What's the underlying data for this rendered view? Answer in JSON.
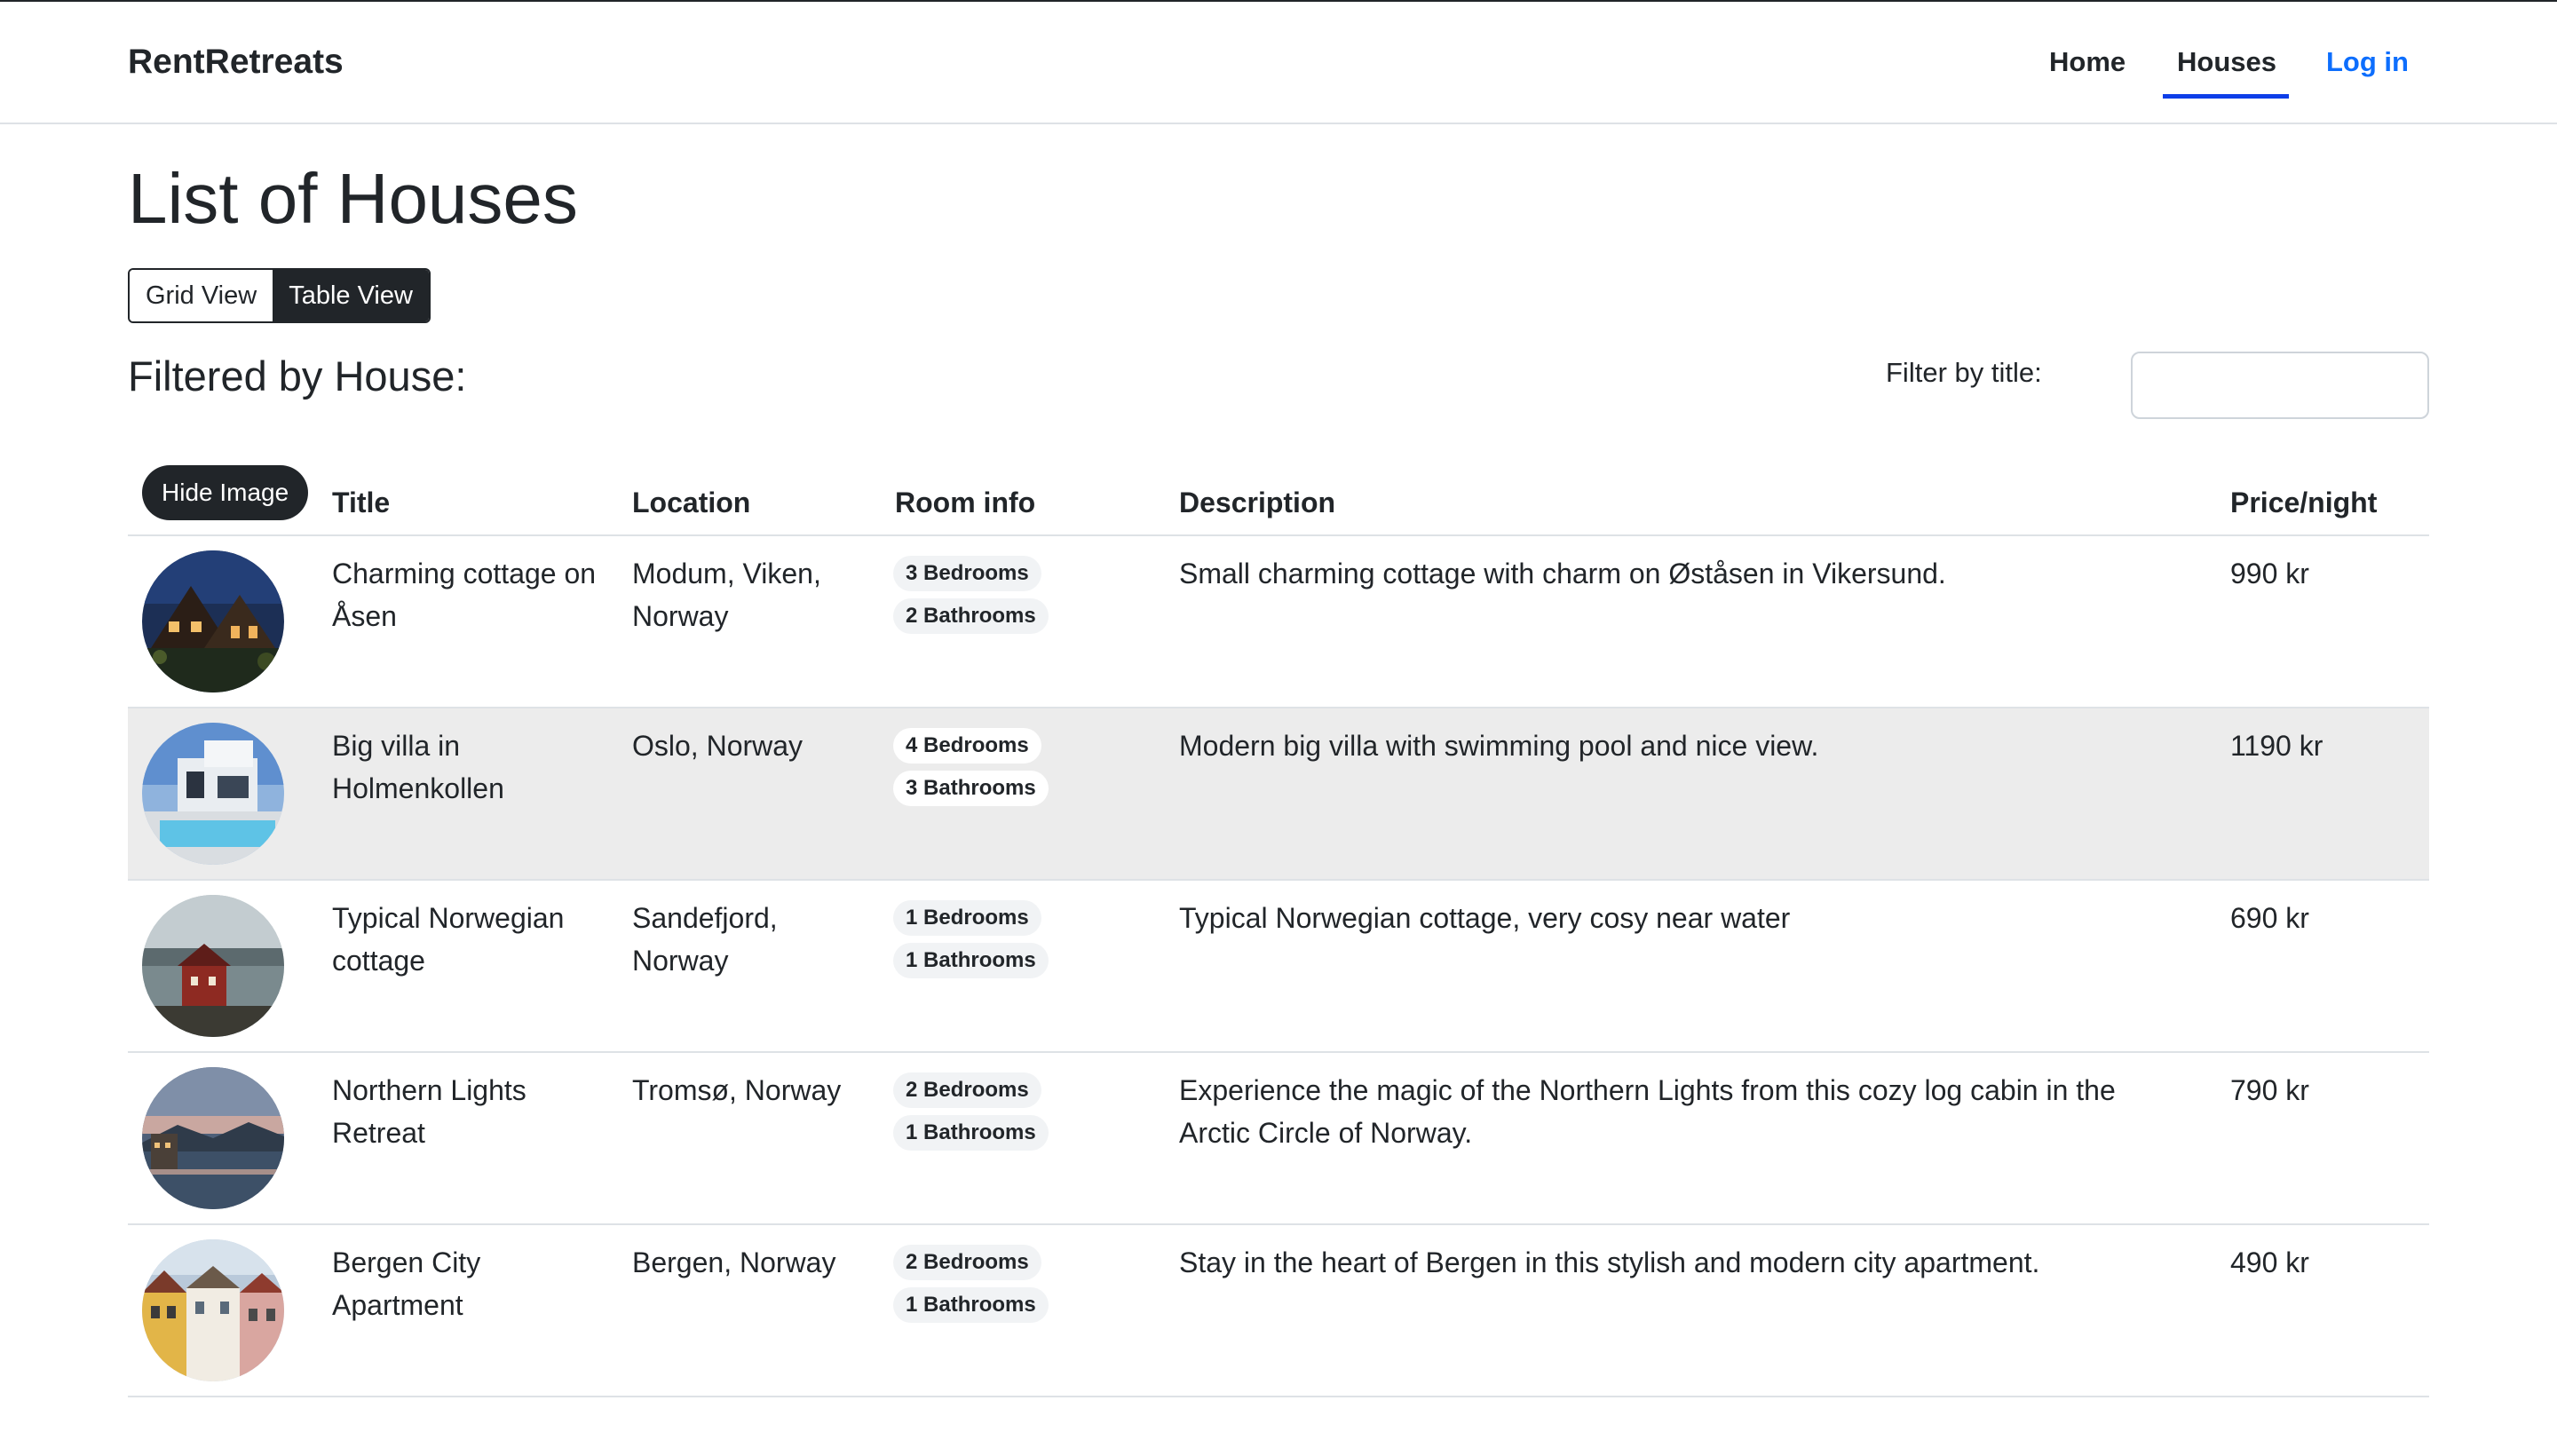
{
  "navbar": {
    "brand": "RentRetreats",
    "links": [
      {
        "label": "Home"
      },
      {
        "label": "Houses",
        "active": true
      },
      {
        "label": "Log in"
      }
    ],
    "accent_color": "#0d6efd"
  },
  "page": {
    "title": "List of Houses",
    "view_toggle": {
      "grid_label": "Grid View",
      "table_label": "Table View",
      "selected": "Table View"
    },
    "filtered_by": "Filtered by House:",
    "filter": {
      "label": "Filter by title:",
      "value": "",
      "placeholder": ""
    }
  },
  "table": {
    "hide_image_label": "Hide Image",
    "columns": {
      "title": "Title",
      "location": "Location",
      "room_info": "Room info",
      "description": "Description",
      "price": "Price/night"
    },
    "rows": [
      {
        "title": "Charming cottage on Åsen",
        "location": "Modum, Viken, Norway",
        "bedrooms": "3 Bedrooms",
        "bathrooms": "2 Bathrooms",
        "description": "Small charming cottage with charm on Øståsen in Vikersund.",
        "price": "990 kr",
        "image": "night-cottage-photo"
      },
      {
        "title": "Big villa in Holmenkollen",
        "location": "Oslo, Norway",
        "bedrooms": "4 Bedrooms",
        "bathrooms": "3 Bathrooms",
        "description": "Modern big villa with swimming pool and nice view.",
        "price": "1190 kr",
        "image": "modern-villa-pool-photo"
      },
      {
        "title": "Typical Norwegian cottage",
        "location": "Sandefjord, Norway",
        "bedrooms": "1 Bedrooms",
        "bathrooms": "1 Bathrooms",
        "description": "Typical Norwegian cottage, very cosy near water",
        "price": "690 kr",
        "image": "red-cottage-water-photo"
      },
      {
        "title": "Northern Lights Retreat",
        "location": "Tromsø, Norway",
        "bedrooms": "2 Bedrooms",
        "bathrooms": "1 Bathrooms",
        "description": "Experience the magic of the Northern Lights from this cozy log cabin in the Arctic Circle of Norway.",
        "price": "790 kr",
        "image": "fjord-dusk-photo"
      },
      {
        "title": "Bergen City Apartment",
        "location": "Bergen, Norway",
        "bedrooms": "2 Bedrooms",
        "bathrooms": "1 Bathrooms",
        "description": "Stay in the heart of Bergen in this stylish and modern city apartment.",
        "price": "490 kr",
        "image": "bergen-houses-photo"
      }
    ]
  }
}
